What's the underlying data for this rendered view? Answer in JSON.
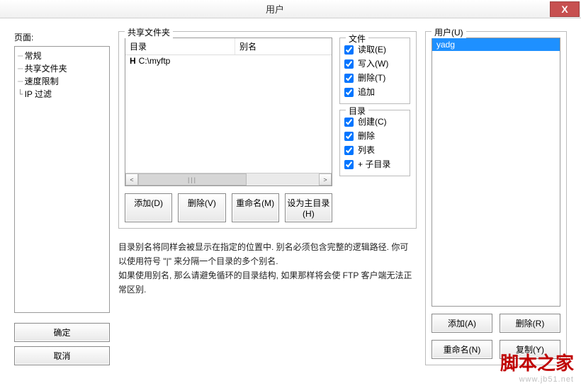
{
  "window": {
    "title": "用户",
    "close": "X"
  },
  "page": {
    "label": "页面:",
    "items": [
      "常规",
      "共享文件夹",
      "速度限制",
      "IP 过滤"
    ],
    "selected_index": 1
  },
  "shared": {
    "legend": "共享文件夹",
    "headers": {
      "dir": "目录",
      "alias": "别名"
    },
    "rows": [
      {
        "h": "H",
        "path": "C:\\myftp",
        "alias": ""
      }
    ],
    "scroll_thumb": "|||",
    "scroll_left": "<",
    "scroll_right": ">",
    "buttons": {
      "add": "添加(D)",
      "del": "删除(V)",
      "rename": "重命名(M)",
      "sethome": "设为主目录(H)"
    }
  },
  "perm_file": {
    "legend": "文件",
    "items": [
      {
        "label": "读取(E)",
        "checked": true
      },
      {
        "label": "写入(W)",
        "checked": true
      },
      {
        "label": "删除(T)",
        "checked": true
      },
      {
        "label": "追加",
        "checked": true
      }
    ]
  },
  "perm_dir": {
    "legend": "目录",
    "items": [
      {
        "label": "创建(C)",
        "checked": true
      },
      {
        "label": "删除",
        "checked": true
      },
      {
        "label": "列表",
        "checked": true
      },
      {
        "label": "+ 子目录",
        "checked": true
      }
    ]
  },
  "hint": {
    "line1": "目录别名将同样会被显示在指定的位置中. 别名必须包含完整的逻辑路径. 你可以使用符号 \"|\" 来分隔一个目录的多个别名.",
    "line2": "如果使用别名, 那么请避免循环的目录结构, 如果那样将会使 FTP 客户端无法正常区别."
  },
  "users": {
    "legend": "用户(U)",
    "items": [
      "yadg"
    ],
    "selected_index": 0,
    "buttons": {
      "add": "添加(A)",
      "del": "删除(R)",
      "rename": "重命名(N)",
      "copy": "复制(Y)"
    }
  },
  "bottom": {
    "ok": "确定",
    "cancel": "取消"
  },
  "watermark": {
    "text": "脚本之家",
    "url": "www.jb51.net"
  }
}
